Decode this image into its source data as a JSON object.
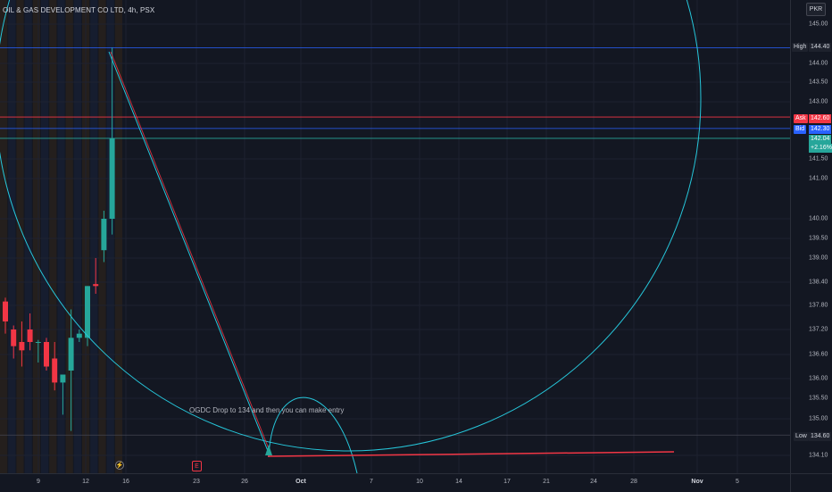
{
  "symbol": {
    "title": "OIL & GAS DEVELOPMENT CO LTD, 4h, PSX"
  },
  "currency": "PKR",
  "price_axis": {
    "ticks": [
      "145.00",
      "144.00",
      "143.50",
      "143.00",
      "141.50",
      "141.00",
      "140.00",
      "139.50",
      "139.00",
      "138.40",
      "137.80",
      "137.20",
      "136.60",
      "136.00",
      "135.50",
      "135.00",
      "134.10"
    ],
    "high": {
      "label": "High",
      "value": "144.40"
    },
    "ask": {
      "label": "Ask",
      "value": "142.60"
    },
    "bid": {
      "label": "Bid",
      "value": "142.30"
    },
    "last": {
      "value": "142.04",
      "change": "+2.16%"
    },
    "low": {
      "label": "Low",
      "value": "134.60"
    }
  },
  "time_axis": {
    "labels": [
      "9",
      "12",
      "16",
      "23",
      "26",
      "Oct",
      "7",
      "10",
      "14",
      "17",
      "21",
      "24",
      "28",
      "Nov",
      "5"
    ]
  },
  "annotation": "OGDC Drop to 134 and then you can make entry",
  "colors": {
    "up": "#26a69a",
    "down": "#f23645",
    "arc": "#26c6da",
    "high_line": "#2962ff",
    "ask": "#f23645",
    "bid": "#2962ff"
  },
  "icons": {
    "event1": "dividend-icon",
    "event2": "earnings-icon"
  },
  "chart_data": {
    "type": "candlestick",
    "candles": [
      {
        "open": 137.9,
        "high": 138.0,
        "low": 137.1,
        "close": 137.4
      },
      {
        "open": 137.2,
        "high": 137.3,
        "low": 136.5,
        "close": 136.8
      },
      {
        "open": 136.9,
        "high": 137.4,
        "low": 136.3,
        "close": 136.7
      },
      {
        "open": 137.2,
        "high": 137.6,
        "low": 136.7,
        "close": 136.9
      },
      {
        "open": 136.9,
        "high": 136.95,
        "low": 136.4,
        "close": 136.9
      },
      {
        "open": 136.9,
        "high": 137.0,
        "low": 136.2,
        "close": 136.3
      },
      {
        "open": 136.5,
        "high": 136.9,
        "low": 135.7,
        "close": 135.9
      },
      {
        "open": 135.9,
        "high": 136.1,
        "low": 135.1,
        "close": 136.1
      },
      {
        "open": 136.2,
        "high": 137.7,
        "low": 134.7,
        "close": 137.0
      },
      {
        "open": 137.0,
        "high": 137.2,
        "low": 136.9,
        "close": 137.1
      },
      {
        "open": 137.0,
        "high": 138.3,
        "low": 136.8,
        "close": 138.3
      },
      {
        "open": 138.35,
        "high": 139.0,
        "low": 138.1,
        "close": 138.3
      },
      {
        "open": 139.2,
        "high": 140.2,
        "low": 138.9,
        "close": 140.0
      },
      {
        "open": 140.0,
        "high": 144.4,
        "low": 139.6,
        "close": 142.04
      }
    ],
    "high": 144.4,
    "low": 134.6,
    "ask": 142.6,
    "bid": 142.3,
    "last": 142.04,
    "change_percent": "+2.16%"
  }
}
